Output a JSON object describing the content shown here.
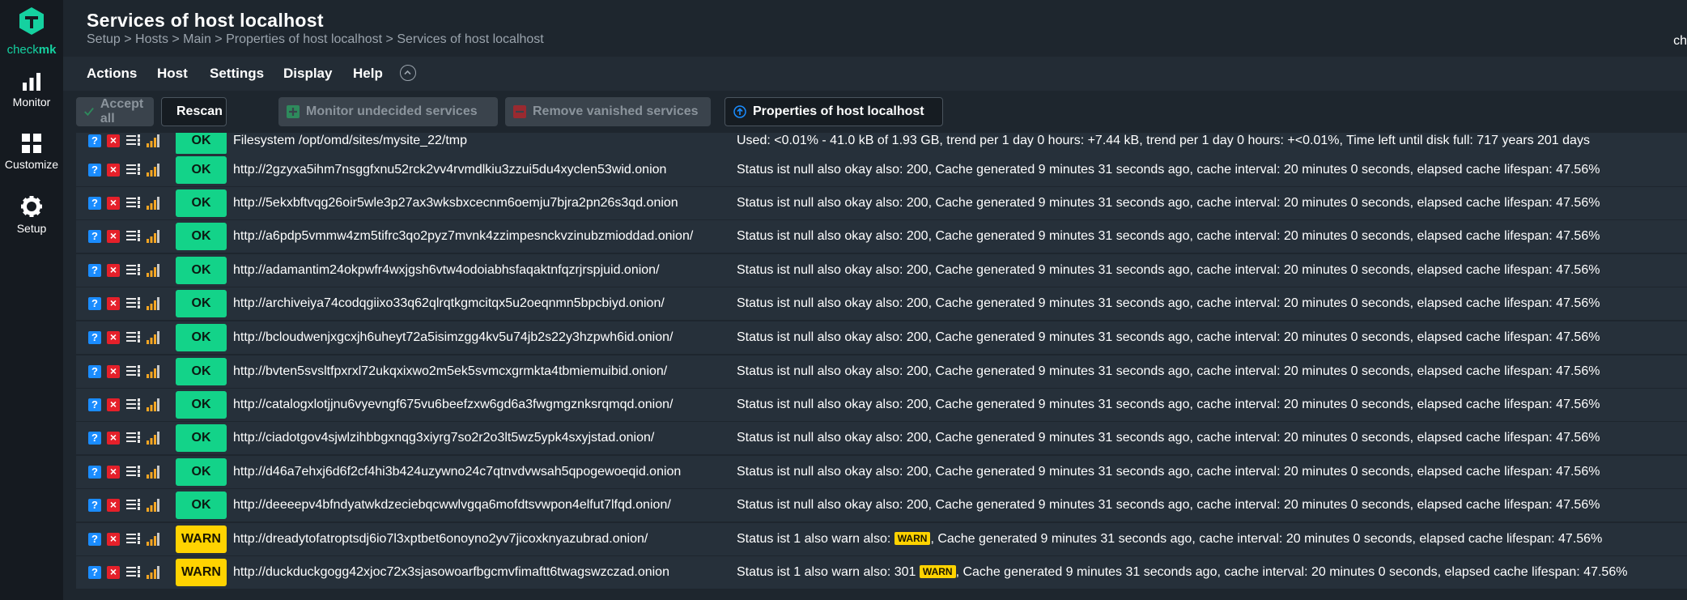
{
  "brand": {
    "name_part1": "check",
    "name_part2": "mk",
    "accent": "#15d1a0"
  },
  "sidebar": {
    "items": [
      {
        "label": "Monitor",
        "icon": "monitor-icon"
      },
      {
        "label": "Customize",
        "icon": "customize-icon"
      },
      {
        "label": "Setup",
        "icon": "gear-icon"
      }
    ]
  },
  "header": {
    "title": "Services of host localhost",
    "breadcrumb": "Setup > Hosts > Main > Properties of host localhost > Services of host localhost",
    "user_abbrev": "ch"
  },
  "menubar": {
    "items": [
      "Actions",
      "Host",
      "Settings",
      "Display",
      "Help"
    ]
  },
  "toolbar": {
    "accept_all": "Accept all",
    "rescan": "Rescan",
    "monitor_undecided": "Monitor undecided services",
    "remove_vanished": "Remove vanished services",
    "properties": "Properties of host localhost"
  },
  "colors": {
    "ok": "#13d389",
    "warn": "#ffd300",
    "help": "#1a8cff",
    "delete": "#e5202a"
  },
  "services": [
    {
      "state": "OK",
      "name": "Filesystem /opt/omd/sites/mysite_22/tmp",
      "output": "Used: <0.01% - 41.0 kB of 1.93 GB, trend per 1 day 0 hours: +7.44 kB, trend per 1 day 0 hours: +<0.01%, Time left until disk full: 717 years 201 days"
    },
    {
      "state": "OK",
      "name": "http://2gzyxa5ihm7nsggfxnu52rck2vv4rvmdlkiu3zzui5du4xyclen53wid.onion",
      "output": "Status ist null also okay also: 200, Cache generated 9 minutes 31 seconds ago, cache interval: 20 minutes 0 seconds, elapsed cache lifespan: 47.56%"
    },
    {
      "state": "OK",
      "name": "http://5ekxbftvqg26oir5wle3p27ax3wksbxcecnm6oemju7bjra2pn26s3qd.onion",
      "output": "Status ist null also okay also: 200, Cache generated 9 minutes 31 seconds ago, cache interval: 20 minutes 0 seconds, elapsed cache lifespan: 47.56%"
    },
    {
      "state": "OK",
      "name": "http://a6pdp5vmmw4zm5tifrc3qo2pyz7mvnk4zzimpesnckvzinubzmioddad.onion/",
      "output": "Status ist null also okay also: 200, Cache generated 9 minutes 31 seconds ago, cache interval: 20 minutes 0 seconds, elapsed cache lifespan: 47.56%"
    },
    {
      "state": "OK",
      "name": "http://adamantim24okpwfr4wxjgsh6vtw4odoiabhsfaqaktnfqzrjrspjuid.onion/",
      "output": "Status ist null also okay also: 200, Cache generated 9 minutes 31 seconds ago, cache interval: 20 minutes 0 seconds, elapsed cache lifespan: 47.56%"
    },
    {
      "state": "OK",
      "name": "http://archiveiya74codqgiixo33q62qlrqtkgmcitqx5u2oeqnmn5bpcbiyd.onion/",
      "output": "Status ist null also okay also: 200, Cache generated 9 minutes 31 seconds ago, cache interval: 20 minutes 0 seconds, elapsed cache lifespan: 47.56%"
    },
    {
      "state": "OK",
      "name": "http://bcloudwenjxgcxjh6uheyt72a5isimzgg4kv5u74jb2s22y3hzpwh6id.onion/",
      "output": "Status ist null also okay also: 200, Cache generated 9 minutes 31 seconds ago, cache interval: 20 minutes 0 seconds, elapsed cache lifespan: 47.56%"
    },
    {
      "state": "OK",
      "name": "http://bvten5svsltfpxrxl72ukqxixwo2m5ek5svmcxgrmkta4tbmiemuibid.onion/",
      "output": "Status ist null also okay also: 200, Cache generated 9 minutes 31 seconds ago, cache interval: 20 minutes 0 seconds, elapsed cache lifespan: 47.56%"
    },
    {
      "state": "OK",
      "name": "http://catalogxlotjjnu6vyevngf675vu6beefzxw6gd6a3fwgmgznksrqmqd.onion/",
      "output": "Status ist null also okay also: 200, Cache generated 9 minutes 31 seconds ago, cache interval: 20 minutes 0 seconds, elapsed cache lifespan: 47.56%"
    },
    {
      "state": "OK",
      "name": "http://ciadotgov4sjwlzihbbgxnqg3xiyrg7so2r2o3lt5wz5ypk4sxyjstad.onion/",
      "output": "Status ist null also okay also: 200, Cache generated 9 minutes 31 seconds ago, cache interval: 20 minutes 0 seconds, elapsed cache lifespan: 47.56%"
    },
    {
      "state": "OK",
      "name": "http://d46a7ehxj6d6f2cf4hi3b424uzywno24c7qtnvdvwsah5qpogewoeqid.onion",
      "output": "Status ist null also okay also: 200, Cache generated 9 minutes 31 seconds ago, cache interval: 20 minutes 0 seconds, elapsed cache lifespan: 47.56%"
    },
    {
      "state": "OK",
      "name": "http://deeeepv4bfndyatwkdzeciebqcwwlvgqa6mofdtsvwpon4elfut7lfqd.onion/",
      "output": "Status ist null also okay also: 200, Cache generated 9 minutes 31 seconds ago, cache interval: 20 minutes 0 seconds, elapsed cache lifespan: 47.56%"
    },
    {
      "state": "WARN",
      "name": "http://dreadytofatroptsdj6io7l3xptbet6onoyno2yv7jicoxknyazubrad.onion/",
      "output_pre": "Status ist 1 also warn also: ",
      "output_badge": "WARN",
      "output_post": ", Cache generated 9 minutes 31 seconds ago, cache interval: 20 minutes 0 seconds, elapsed cache lifespan: 47.56%"
    },
    {
      "state": "WARN",
      "name": "http://duckduckgogg42xjoc72x3sjasowoarfbgcmvfimaftt6twagswzczad.onion",
      "output_pre": "Status ist 1 also warn also: 301 ",
      "output_badge": "WARN",
      "output_post": ", Cache generated 9 minutes 31 seconds ago, cache interval: 20 minutes 0 seconds, elapsed cache lifespan: 47.56%"
    }
  ]
}
